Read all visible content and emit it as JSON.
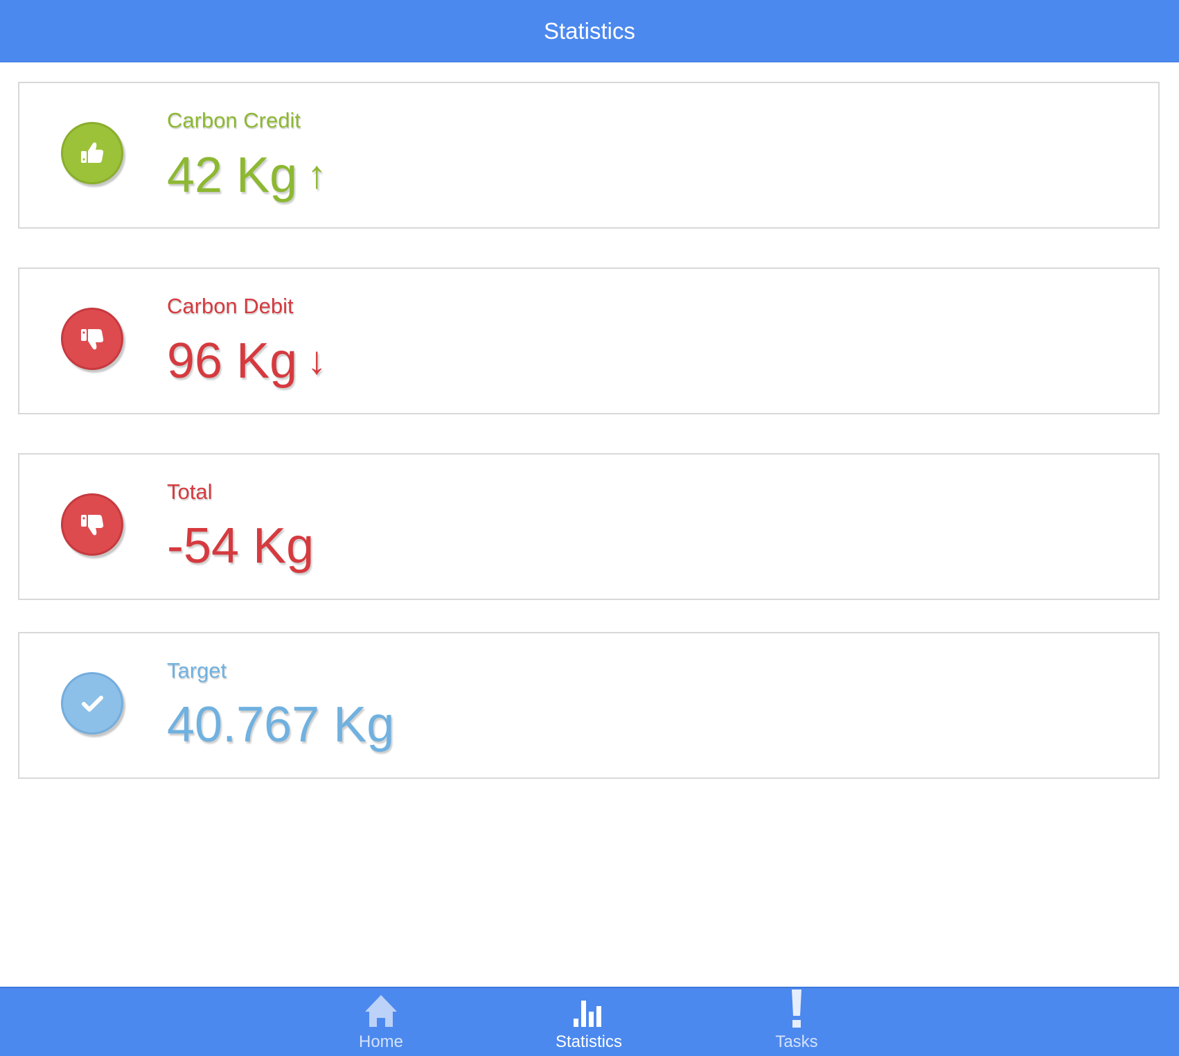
{
  "header": {
    "title": "Statistics"
  },
  "cards": [
    {
      "label": "Carbon Credit",
      "value": "42 Kg",
      "trend": "↑",
      "icon": "thumbs-up-icon",
      "color": "#8db832"
    },
    {
      "label": "Carbon Debit",
      "value": "96 Kg",
      "trend": "↓",
      "icon": "thumbs-down-icon",
      "color": "#d53a3f"
    },
    {
      "label": "Total",
      "value": "-54 Kg",
      "icon": "thumbs-down-icon",
      "color": "#d53a3f"
    },
    {
      "label": "Target",
      "value": "40.767 Kg",
      "icon": "check-icon",
      "color": "#6fb1e0"
    }
  ],
  "tabbar": {
    "tabs": [
      {
        "label": "Home",
        "icon": "home-icon",
        "active": false
      },
      {
        "label": "Statistics",
        "icon": "bar-chart-icon",
        "active": true
      },
      {
        "label": "Tasks",
        "icon": "exclamation-icon",
        "active": false
      }
    ]
  },
  "colors": {
    "primary": "#4c89ee",
    "credit": "#8db832",
    "debit": "#d53a3f",
    "target": "#6fb1e0"
  }
}
